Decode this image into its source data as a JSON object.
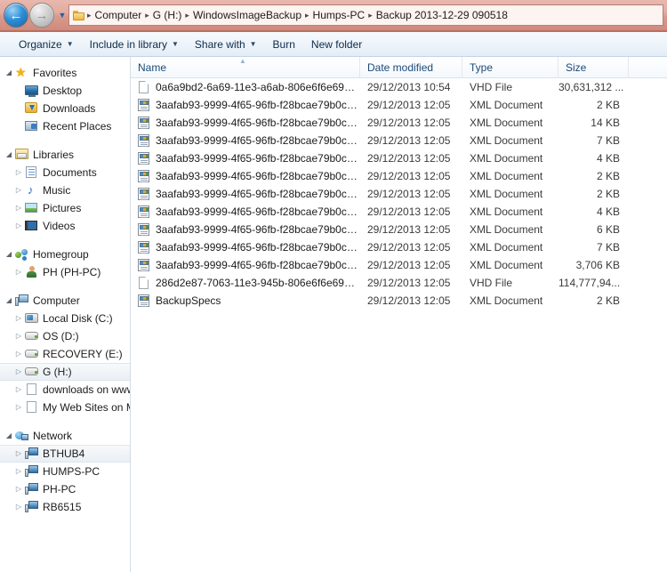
{
  "address": {
    "back_label": "Back",
    "forward_label": "Forward",
    "history_label": "Recent pages",
    "folder_icon": "folder-icon",
    "crumbs": [
      "Computer",
      "G (H:)",
      "WindowsImageBackup",
      "Humps-PC",
      "Backup 2013-12-29 090518"
    ],
    "separator": "▸"
  },
  "toolbar": {
    "items": [
      {
        "label": "Organize",
        "caret": "▼"
      },
      {
        "label": "Include in library",
        "caret": "▼"
      },
      {
        "label": "Share with",
        "caret": "▼"
      },
      {
        "label": "Burn",
        "caret": ""
      },
      {
        "label": "New folder",
        "caret": ""
      }
    ]
  },
  "sidebar": {
    "items": [
      {
        "label": "Favorites",
        "icon": "star-icon",
        "indent": 0,
        "twisty": "open",
        "selected": false
      },
      {
        "label": "Desktop",
        "icon": "desktop-icon",
        "indent": 1,
        "twisty": "none",
        "selected": false
      },
      {
        "label": "Downloads",
        "icon": "downloads-icon",
        "indent": 1,
        "twisty": "none",
        "selected": false
      },
      {
        "label": "Recent Places",
        "icon": "recent-places-icon",
        "indent": 1,
        "twisty": "none",
        "selected": false
      },
      {
        "label": "",
        "icon": "",
        "indent": 0,
        "twisty": "",
        "spacer": true
      },
      {
        "label": "Libraries",
        "icon": "libraries-icon",
        "indent": 0,
        "twisty": "open",
        "selected": false
      },
      {
        "label": "Documents",
        "icon": "documents-icon",
        "indent": 1,
        "twisty": "closed",
        "selected": false
      },
      {
        "label": "Music",
        "icon": "music-icon",
        "indent": 1,
        "twisty": "closed",
        "selected": false
      },
      {
        "label": "Pictures",
        "icon": "pictures-icon",
        "indent": 1,
        "twisty": "closed",
        "selected": false
      },
      {
        "label": "Videos",
        "icon": "videos-icon",
        "indent": 1,
        "twisty": "closed",
        "selected": false
      },
      {
        "label": "",
        "icon": "",
        "indent": 0,
        "twisty": "",
        "spacer": true
      },
      {
        "label": "Homegroup",
        "icon": "homegroup-icon",
        "indent": 0,
        "twisty": "open",
        "selected": false
      },
      {
        "label": "PH (PH-PC)",
        "icon": "user-icon",
        "indent": 1,
        "twisty": "closed",
        "selected": false
      },
      {
        "label": "",
        "icon": "",
        "indent": 0,
        "twisty": "",
        "spacer": true
      },
      {
        "label": "Computer",
        "icon": "computer-icon",
        "indent": 0,
        "twisty": "open",
        "selected": false
      },
      {
        "label": "Local Disk (C:)",
        "icon": "system-drive-icon",
        "indent": 1,
        "twisty": "closed",
        "selected": false
      },
      {
        "label": "OS (D:)",
        "icon": "drive-icon",
        "indent": 1,
        "twisty": "closed",
        "selected": false
      },
      {
        "label": "RECOVERY (E:)",
        "icon": "drive-icon",
        "indent": 1,
        "twisty": "closed",
        "selected": false
      },
      {
        "label": "G (H:)",
        "icon": "drive-icon",
        "indent": 1,
        "twisty": "closed",
        "selected": true
      },
      {
        "label": "downloads on www",
        "icon": "network-folder-icon",
        "indent": 1,
        "twisty": "closed",
        "selected": false
      },
      {
        "label": "My Web Sites on MS",
        "icon": "network-folder-icon",
        "indent": 1,
        "twisty": "closed",
        "selected": false
      },
      {
        "label": "",
        "icon": "",
        "indent": 0,
        "twisty": "",
        "spacer": true
      },
      {
        "label": "Network",
        "icon": "network-icon",
        "indent": 0,
        "twisty": "open",
        "selected": false
      },
      {
        "label": "BTHUB4",
        "icon": "network-pc-icon",
        "indent": 1,
        "twisty": "closed",
        "selected": true
      },
      {
        "label": "HUMPS-PC",
        "icon": "network-pc-icon",
        "indent": 1,
        "twisty": "closed",
        "selected": false
      },
      {
        "label": "PH-PC",
        "icon": "network-pc-icon",
        "indent": 1,
        "twisty": "closed",
        "selected": false
      },
      {
        "label": "RB6515",
        "icon": "network-pc-icon",
        "indent": 1,
        "twisty": "closed",
        "selected": false
      }
    ]
  },
  "filelist": {
    "columns": {
      "name": "Name",
      "date_modified": "Date modified",
      "type": "Type",
      "size": "Size"
    },
    "sort_column": "Name",
    "sort_direction_glyph": "▲",
    "rows": [
      {
        "name": "0a6a9bd2-6a69-11e3-a6ab-806e6f6e6963....",
        "date": "29/12/2013 10:54",
        "type": "VHD File",
        "size": "30,631,312 ...",
        "icon": "blank-file-icon"
      },
      {
        "name": "3aafab93-9999-4f65-96fb-f28bcae79b0c_...",
        "date": "29/12/2013 12:05",
        "type": "XML Document",
        "size": "2 KB",
        "icon": "xml-file-icon"
      },
      {
        "name": "3aafab93-9999-4f65-96fb-f28bcae79b0c_...",
        "date": "29/12/2013 12:05",
        "type": "XML Document",
        "size": "14 KB",
        "icon": "xml-file-icon"
      },
      {
        "name": "3aafab93-9999-4f65-96fb-f28bcae79b0c_...",
        "date": "29/12/2013 12:05",
        "type": "XML Document",
        "size": "7 KB",
        "icon": "xml-file-icon"
      },
      {
        "name": "3aafab93-9999-4f65-96fb-f28bcae79b0c_...",
        "date": "29/12/2013 12:05",
        "type": "XML Document",
        "size": "4 KB",
        "icon": "xml-file-icon"
      },
      {
        "name": "3aafab93-9999-4f65-96fb-f28bcae79b0c_...",
        "date": "29/12/2013 12:05",
        "type": "XML Document",
        "size": "2 KB",
        "icon": "xml-file-icon"
      },
      {
        "name": "3aafab93-9999-4f65-96fb-f28bcae79b0c_...",
        "date": "29/12/2013 12:05",
        "type": "XML Document",
        "size": "2 KB",
        "icon": "xml-file-icon"
      },
      {
        "name": "3aafab93-9999-4f65-96fb-f28bcae79b0c_...",
        "date": "29/12/2013 12:05",
        "type": "XML Document",
        "size": "4 KB",
        "icon": "xml-file-icon"
      },
      {
        "name": "3aafab93-9999-4f65-96fb-f28bcae79b0c_...",
        "date": "29/12/2013 12:05",
        "type": "XML Document",
        "size": "6 KB",
        "icon": "xml-file-icon"
      },
      {
        "name": "3aafab93-9999-4f65-96fb-f28bcae79b0c_...",
        "date": "29/12/2013 12:05",
        "type": "XML Document",
        "size": "7 KB",
        "icon": "xml-file-icon"
      },
      {
        "name": "3aafab93-9999-4f65-96fb-f28bcae79b0c_...",
        "date": "29/12/2013 12:05",
        "type": "XML Document",
        "size": "3,706 KB",
        "icon": "xml-file-icon"
      },
      {
        "name": "286d2e87-7063-11e3-945b-806e6f6e6963....",
        "date": "29/12/2013 12:05",
        "type": "VHD File",
        "size": "114,777,94...",
        "icon": "blank-file-icon"
      },
      {
        "name": "BackupSpecs",
        "date": "29/12/2013 12:05",
        "type": "XML Document",
        "size": "2 KB",
        "icon": "xml-file-icon"
      }
    ]
  }
}
